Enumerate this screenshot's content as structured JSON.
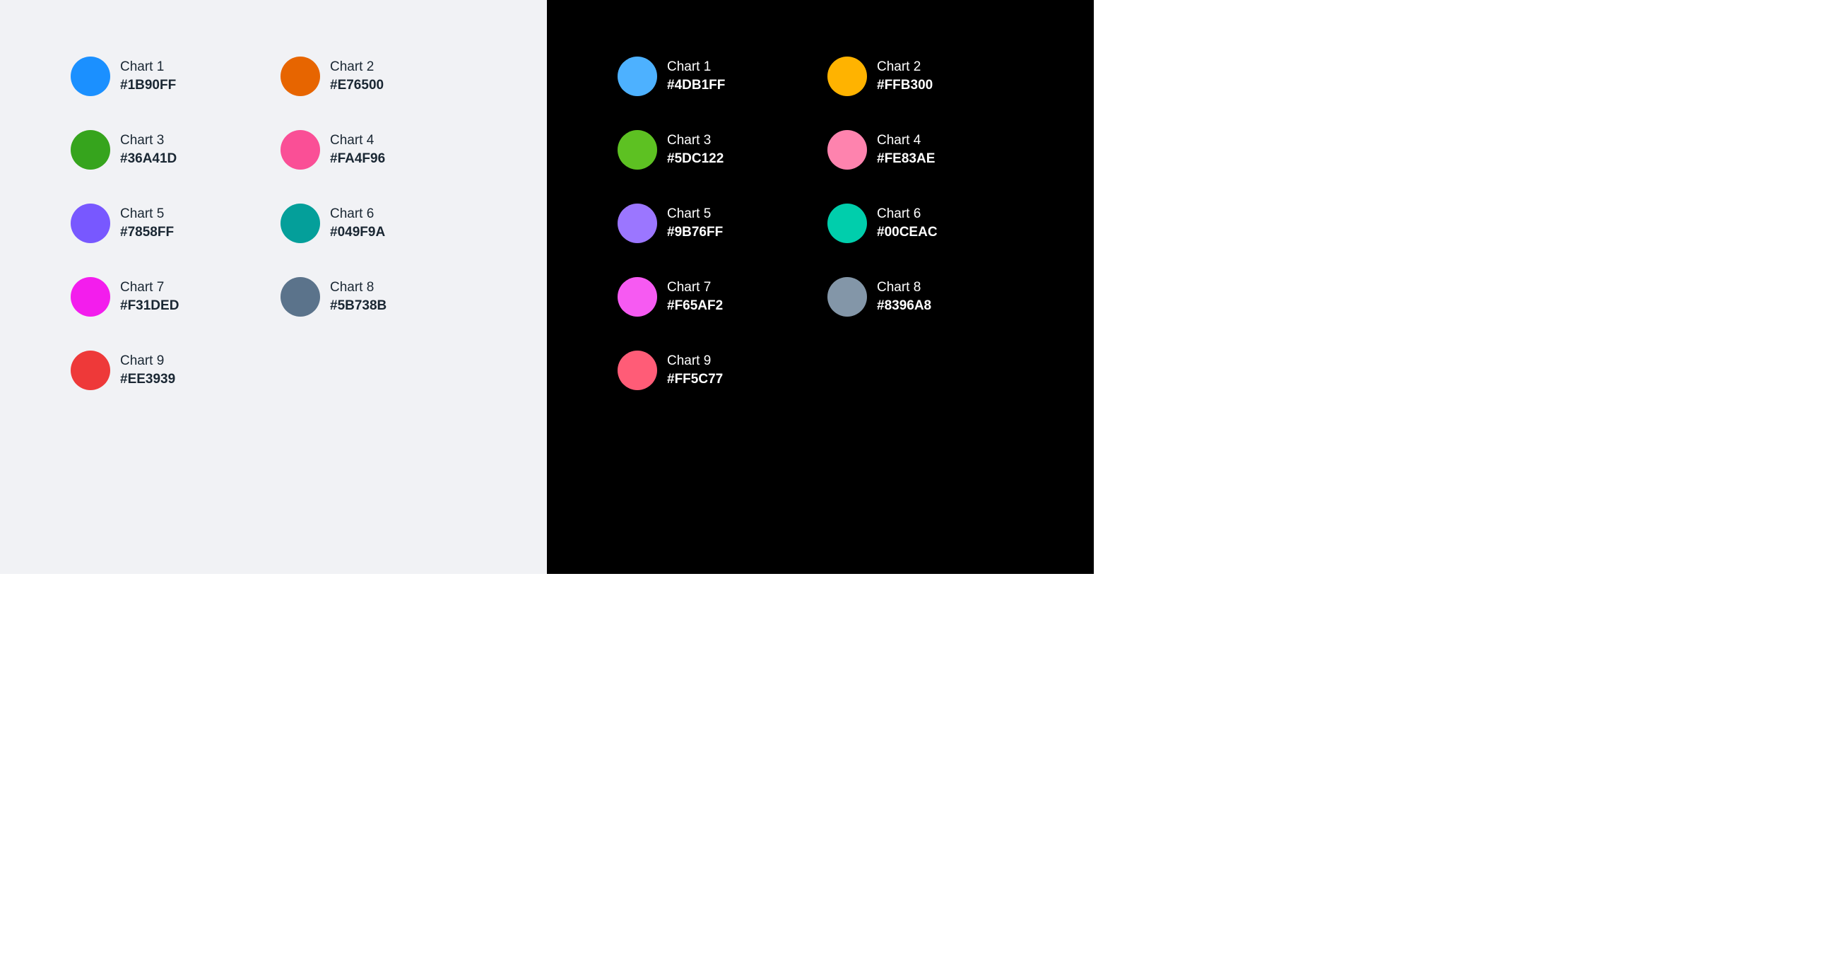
{
  "light": {
    "bg": "#F1F2F5",
    "textColor": "#1A2733",
    "swatches": [
      {
        "label": "Chart 1",
        "hex": "#1B90FF"
      },
      {
        "label": "Chart 2",
        "hex": "#E76500"
      },
      {
        "label": "Chart 3",
        "hex": "#36A41D"
      },
      {
        "label": "Chart 4",
        "hex": "#FA4F96"
      },
      {
        "label": "Chart 5",
        "hex": "#7858FF"
      },
      {
        "label": "Chart 6",
        "hex": "#049F9A"
      },
      {
        "label": "Chart 7",
        "hex": "#F31DED"
      },
      {
        "label": "Chart 8",
        "hex": "#5B738B"
      },
      {
        "label": "Chart 9",
        "hex": "#EE3939"
      }
    ]
  },
  "dark": {
    "bg": "#000000",
    "textColor": "#FFFFFF",
    "swatches": [
      {
        "label": "Chart 1",
        "hex": "#4DB1FF"
      },
      {
        "label": "Chart 2",
        "hex": "#FFB300"
      },
      {
        "label": "Chart 3",
        "hex": "#5DC122"
      },
      {
        "label": "Chart 4",
        "hex": "#FE83AE"
      },
      {
        "label": "Chart 5",
        "hex": "#9B76FF"
      },
      {
        "label": "Chart 6",
        "hex": "#00CEAC"
      },
      {
        "label": "Chart 7",
        "hex": "#F65AF2"
      },
      {
        "label": "Chart 8",
        "hex": "#8396A8"
      },
      {
        "label": "Chart 9",
        "hex": "#FF5C77"
      }
    ]
  }
}
